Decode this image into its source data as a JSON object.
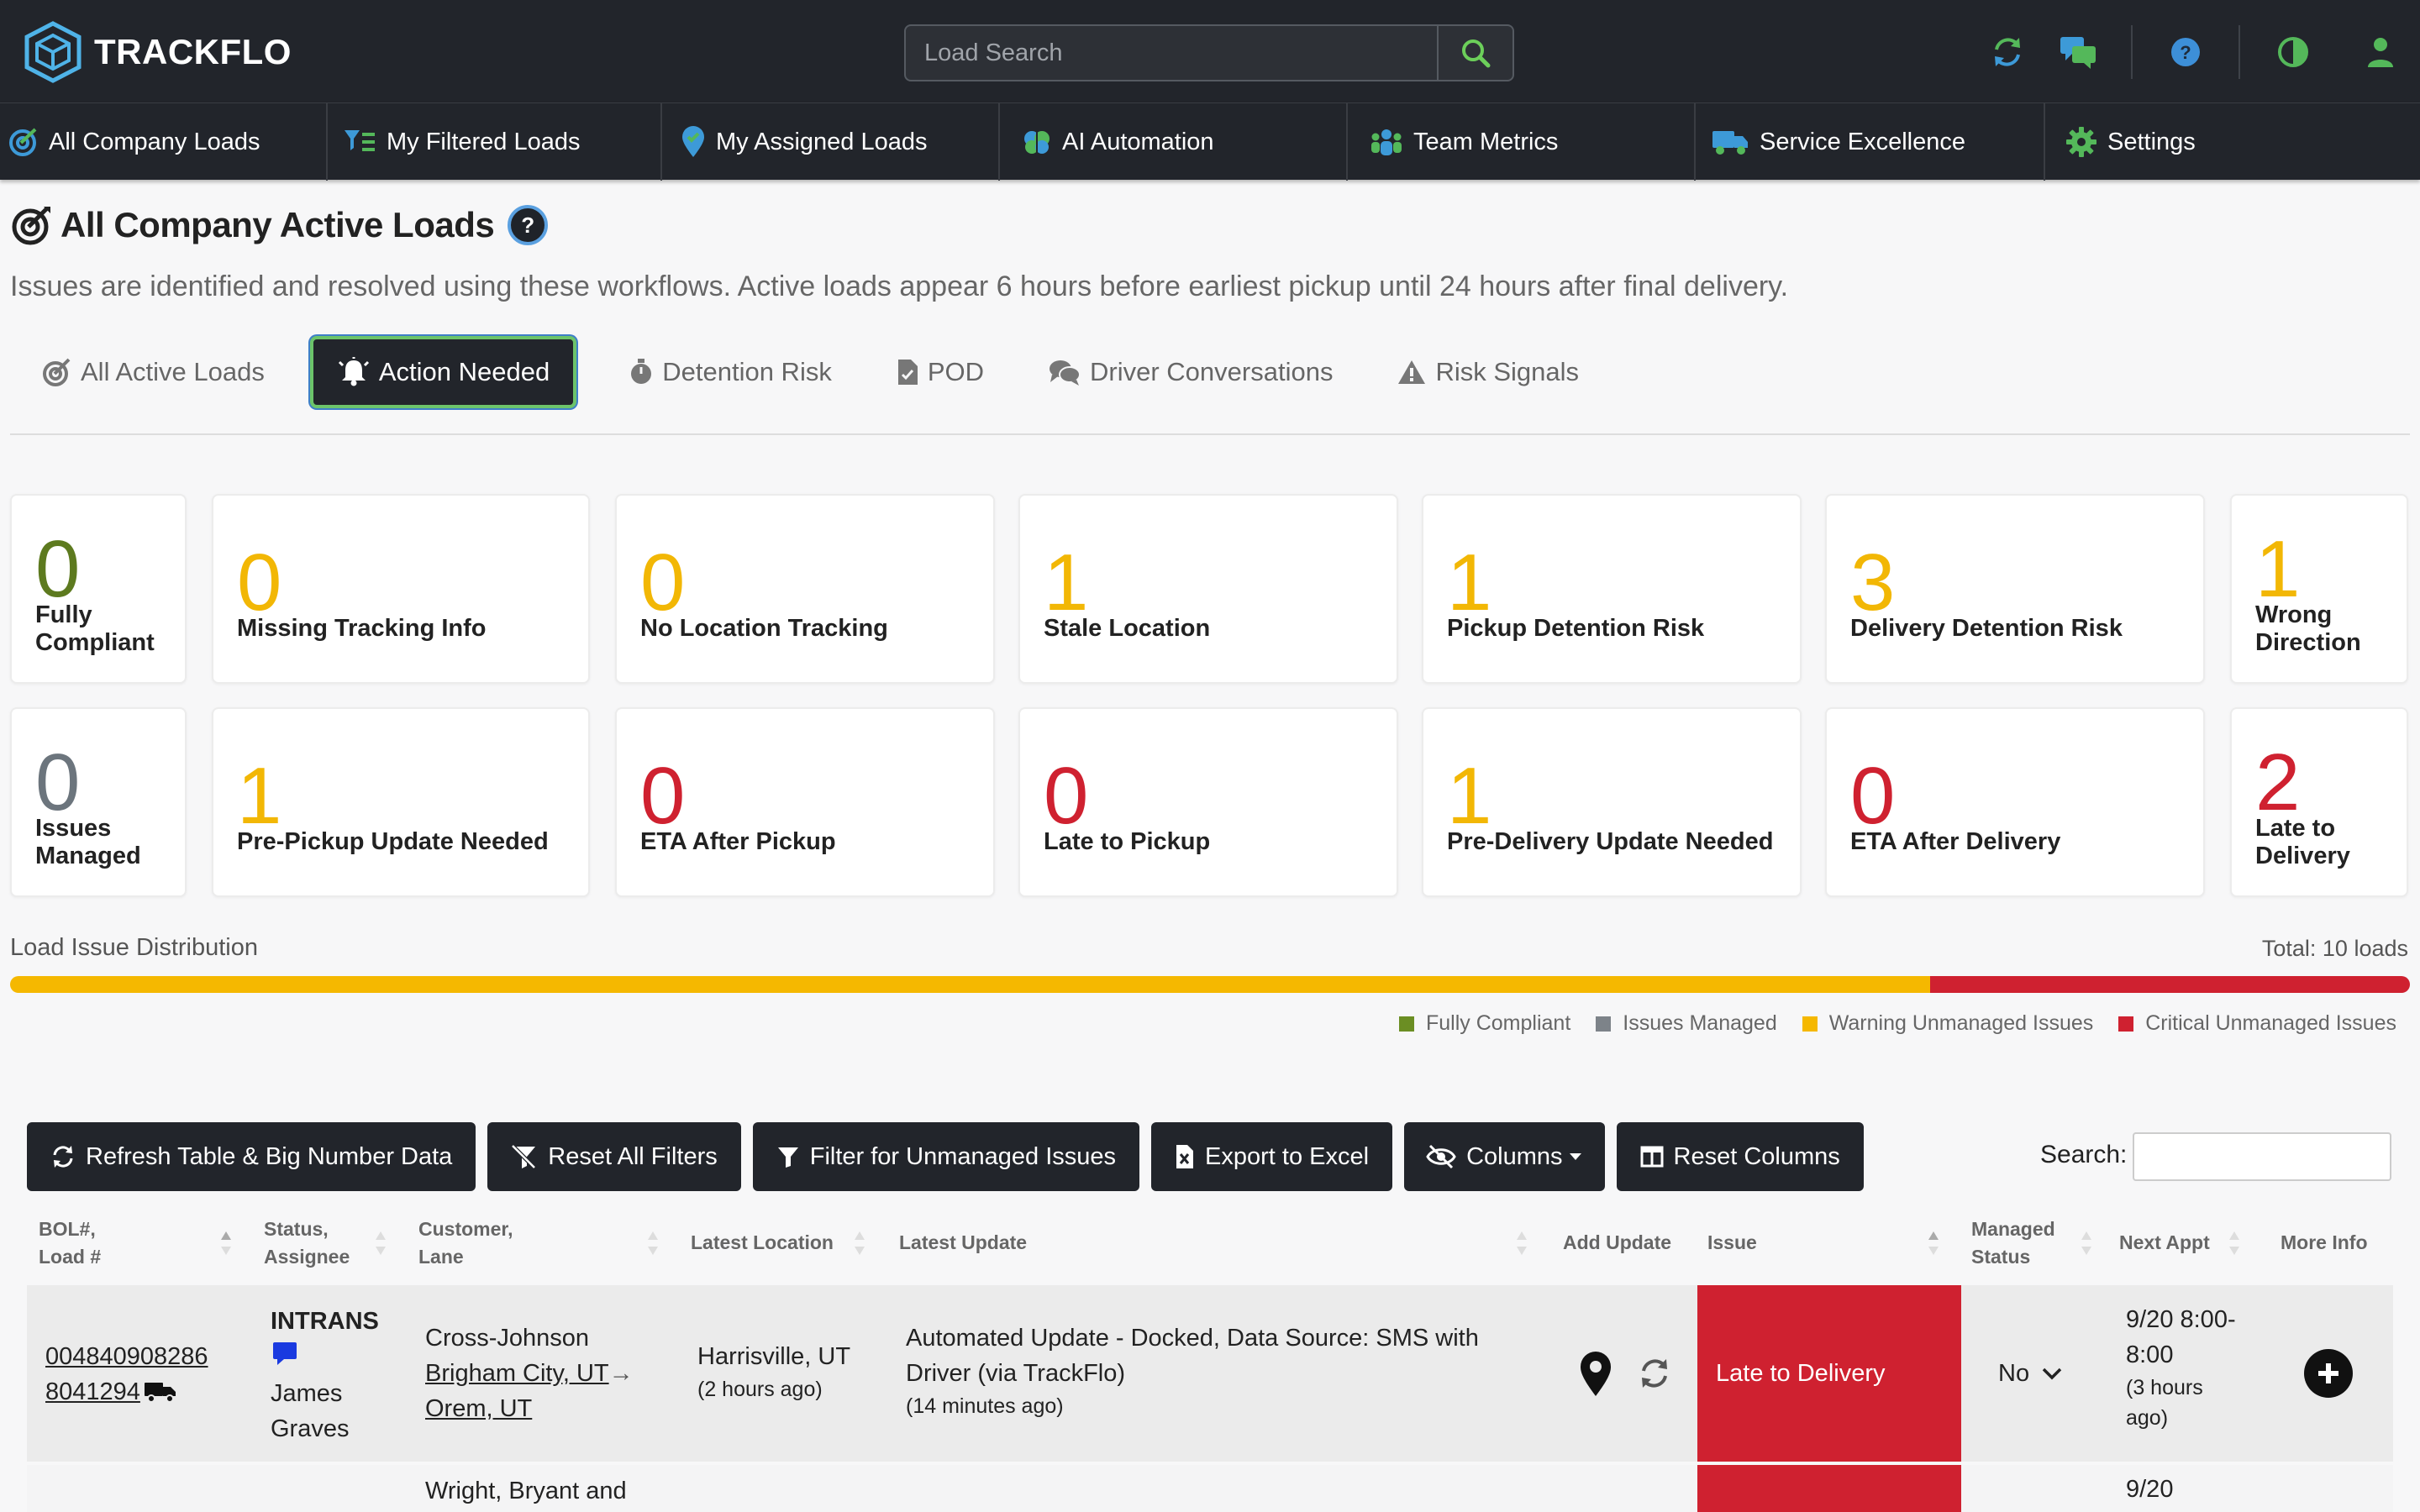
{
  "app": {
    "name": "TRACKFLO"
  },
  "search": {
    "placeholder": "Load Search"
  },
  "nav": {
    "items": [
      {
        "label": "All Company Loads"
      },
      {
        "label": "My Filtered Loads"
      },
      {
        "label": "My Assigned Loads"
      },
      {
        "label": "AI Automation"
      },
      {
        "label": "Team Metrics"
      },
      {
        "label": "Service Excellence"
      },
      {
        "label": "Settings"
      }
    ]
  },
  "page": {
    "title": "All Company Active Loads",
    "help": "?",
    "subtitle": "Issues are identified and resolved using these workflows. Active loads appear 6 hours before earliest pickup until 24 hours after final delivery."
  },
  "tabs": [
    {
      "label": "All Active Loads"
    },
    {
      "label": "Action Needed",
      "active": true
    },
    {
      "label": "Detention Risk"
    },
    {
      "label": "POD"
    },
    {
      "label": "Driver Conversations"
    },
    {
      "label": "Risk Signals"
    }
  ],
  "cards": [
    {
      "value": "0",
      "label": "Fully Compliant",
      "label1": "Fully",
      "label2": "Compliant",
      "color": "#5d7a1f"
    },
    {
      "value": "0",
      "label": "Missing Tracking Info",
      "color": "#f2b705"
    },
    {
      "value": "0",
      "label": "No Location Tracking",
      "color": "#f2b705"
    },
    {
      "value": "1",
      "label": "Stale Location",
      "color": "#f2b705"
    },
    {
      "value": "1",
      "label": "Pickup Detention Risk",
      "color": "#f2b705"
    },
    {
      "value": "3",
      "label": "Delivery Detention Risk",
      "color": "#f2b705"
    },
    {
      "value": "1",
      "label": "Wrong Direction",
      "label1": "Wrong",
      "label2": "Direction",
      "color": "#f2b705"
    },
    {
      "value": "0",
      "label": "Issues Managed",
      "label1": "Issues",
      "label2": "Managed",
      "color": "#6c757d"
    },
    {
      "value": "1",
      "label": "Pre-Pickup Update Needed",
      "color": "#f2b705"
    },
    {
      "value": "0",
      "label": "ETA After Pickup",
      "color": "#cf2130"
    },
    {
      "value": "0",
      "label": "Late to Pickup",
      "color": "#cf2130"
    },
    {
      "value": "1",
      "label": "Pre-Delivery Update Needed",
      "color": "#f2b705"
    },
    {
      "value": "0",
      "label": "ETA After Delivery",
      "color": "#cf2130"
    },
    {
      "value": "2",
      "label": "Late to Delivery",
      "label1": "Late to",
      "label2": "Delivery",
      "color": "#cf2130"
    }
  ],
  "distribution": {
    "label": "Load Issue Distribution",
    "total": "Total: 10 loads",
    "segments": [
      {
        "name": "Warning Unmanaged Issues",
        "fraction": 0.8,
        "color": "#f5b800"
      },
      {
        "name": "Critical Unmanaged Issues",
        "fraction": 0.2,
        "color": "#cf2130"
      }
    ],
    "legend": [
      {
        "name": "Fully Compliant",
        "color": "#6b8e23"
      },
      {
        "name": "Issues Managed",
        "color": "#7d8389"
      },
      {
        "name": "Warning Unmanaged Issues",
        "color": "#f5b800"
      },
      {
        "name": "Critical Unmanaged Issues",
        "color": "#cf2130"
      }
    ]
  },
  "toolbar": {
    "refresh": "Refresh Table & Big Number Data",
    "reset_filters": "Reset All Filters",
    "filter_unmanaged": "Filter for Unmanaged Issues",
    "export": "Export to Excel",
    "columns": "Columns",
    "reset_columns": "Reset Columns",
    "search_label": "Search:"
  },
  "table": {
    "headers": {
      "bol_1": "BOL#,",
      "bol_2": "Load #",
      "status_1": "Status,",
      "status_2": "Assignee",
      "customer_1": "Customer,",
      "customer_2": "Lane",
      "location": "Latest Location",
      "update": "Latest Update",
      "add_update": "Add Update",
      "issue": "Issue",
      "managed_1": "Managed",
      "managed_2": "Status",
      "next_appt": "Next Appt",
      "more_info": "More Info"
    },
    "rows": [
      {
        "bol": "004840908286",
        "load": "8041294",
        "status": "INTRANS",
        "assignee_first": "James",
        "assignee_last": "Graves",
        "customer": "Cross-Johnson",
        "origin": "Brigham City, UT",
        "destination": "Orem, UT",
        "location": "Harrisville, UT",
        "location_age": "(2 hours ago)",
        "update_line1": "Automated Update - Docked, Data Source: SMS with",
        "update_line2": "Driver (via TrackFlo)",
        "update_age": "(14 minutes ago)",
        "issue": "Late to Delivery",
        "managed": "No",
        "appt_line1": "9/20 8:00-",
        "appt_line2": "8:00",
        "appt_age1": "(3 hours",
        "appt_age2": "ago)"
      },
      {
        "customer": "Wright, Bryant and",
        "appt_line1": "9/20"
      }
    ]
  }
}
